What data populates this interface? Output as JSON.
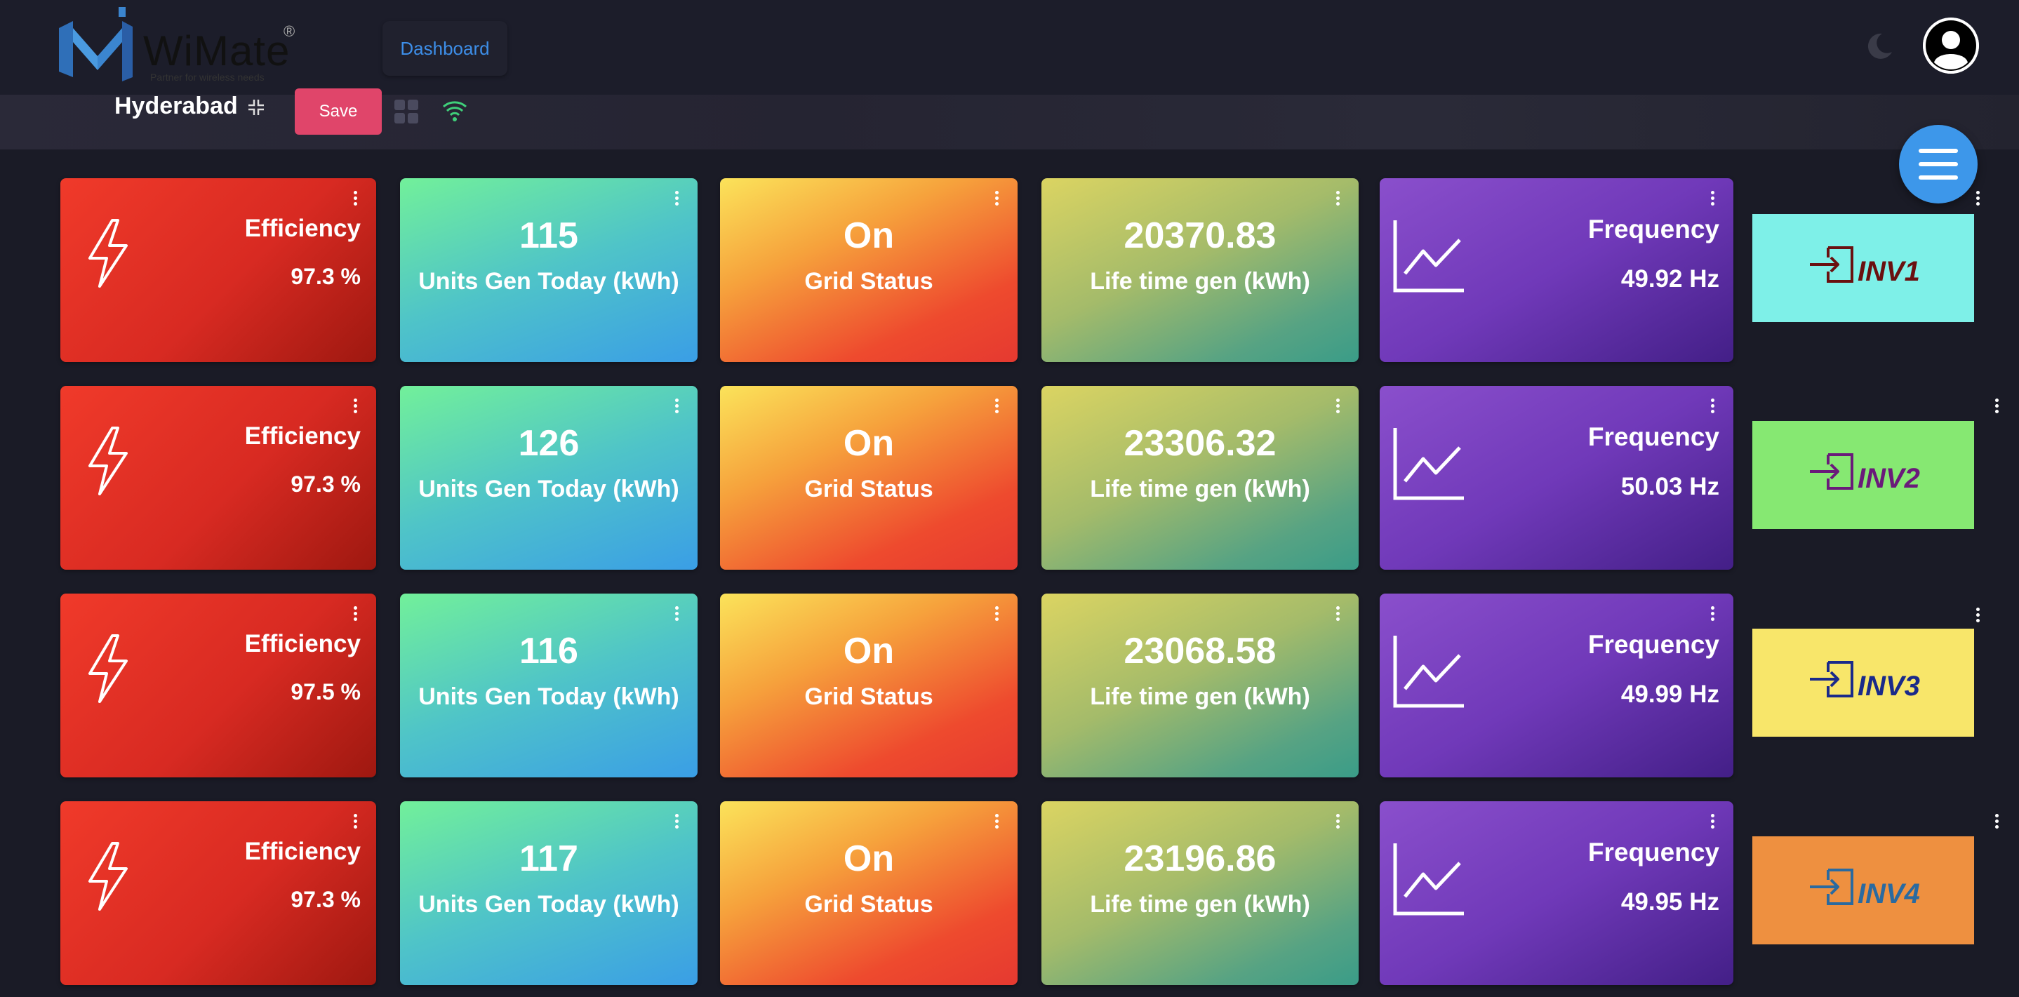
{
  "header": {
    "logo_text": "WiMate",
    "logo_reg": "®",
    "logo_tagline": "Partner for wireless needs",
    "dashboard_label": "Dashboard"
  },
  "subheader": {
    "location": "Hyderabad",
    "save_label": "Save"
  },
  "colors": {
    "save": "#e0456a",
    "fab": "#3d97ea",
    "efficiency": "#e53a2a",
    "units": "#4fc4c8",
    "grid": "#ee4a2e",
    "lifetime": "#9eb86c",
    "frequency": "#7039b9"
  },
  "rows": [
    {
      "efficiency_label": "Efficiency",
      "efficiency_value": "97.3 %",
      "units_value": "115",
      "units_label": "Units Gen Today (kWh)",
      "grid_value": "On",
      "grid_label": "Grid Status",
      "life_value": "20370.83",
      "life_label": "Life time gen (kWh)",
      "freq_label": "Frequency",
      "freq_value": "49.92 Hz",
      "inv_label": "INV1",
      "inv_bg": "#7ef0e8",
      "inv_fg": "#6a1010"
    },
    {
      "efficiency_label": "Efficiency",
      "efficiency_value": "97.3 %",
      "units_value": "126",
      "units_label": "Units Gen Today (kWh)",
      "grid_value": "On",
      "grid_label": "Grid Status",
      "life_value": "23306.32",
      "life_label": "Life time gen (kWh)",
      "freq_label": "Frequency",
      "freq_value": "50.03 Hz",
      "inv_label": "INV2",
      "inv_bg": "#86e872",
      "inv_fg": "#6a1a7a"
    },
    {
      "efficiency_label": "Efficiency",
      "efficiency_value": "97.5 %",
      "units_value": "116",
      "units_label": "Units Gen Today (kWh)",
      "grid_value": "On",
      "grid_label": "Grid Status",
      "life_value": "23068.58",
      "life_label": "Life time gen (kWh)",
      "freq_label": "Frequency",
      "freq_value": "49.99 Hz",
      "inv_label": "INV3",
      "inv_bg": "#f8e66a",
      "inv_fg": "#1a2a8a"
    },
    {
      "efficiency_label": "Efficiency",
      "efficiency_value": "97.3 %",
      "units_value": "117",
      "units_label": "Units Gen Today (kWh)",
      "grid_value": "On",
      "grid_label": "Grid Status",
      "life_value": "23196.86",
      "life_label": "Life time gen (kWh)",
      "freq_label": "Frequency",
      "freq_value": "49.95 Hz",
      "inv_label": "INV4",
      "inv_bg": "#ee9040",
      "inv_fg": "#2a6aa0"
    }
  ]
}
